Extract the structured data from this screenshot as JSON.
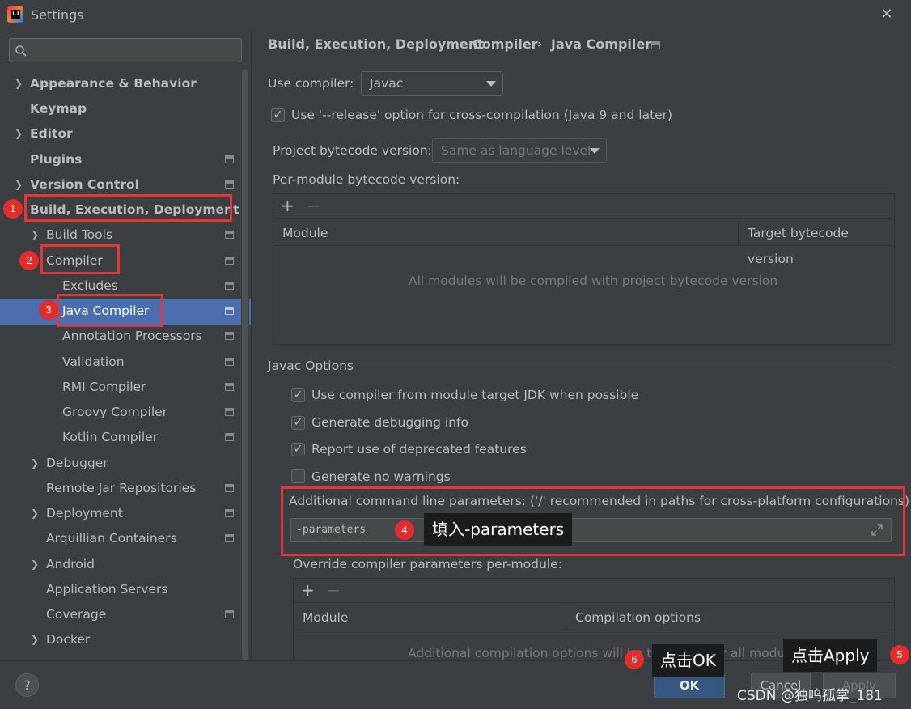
{
  "window": {
    "title": "Settings",
    "close": "✕"
  },
  "search": {
    "placeholder": ""
  },
  "sidebar": {
    "items": [
      {
        "label": "Appearance & Behavior"
      },
      {
        "label": "Keymap"
      },
      {
        "label": "Editor"
      },
      {
        "label": "Plugins"
      },
      {
        "label": "Version Control"
      },
      {
        "label": "Build, Execution, Deployment"
      },
      {
        "label": "Build Tools"
      },
      {
        "label": "Compiler"
      },
      {
        "label": "Excludes"
      },
      {
        "label": "Java Compiler"
      },
      {
        "label": "Annotation Processors"
      },
      {
        "label": "Validation"
      },
      {
        "label": "RMI Compiler"
      },
      {
        "label": "Groovy Compiler"
      },
      {
        "label": "Kotlin Compiler"
      },
      {
        "label": "Debugger"
      },
      {
        "label": "Remote Jar Repositories"
      },
      {
        "label": "Deployment"
      },
      {
        "label": "Arquillian Containers"
      },
      {
        "label": "Android"
      },
      {
        "label": "Application Servers"
      },
      {
        "label": "Coverage"
      },
      {
        "label": "Docker"
      }
    ],
    "selected": "Java Compiler"
  },
  "breadcrumb": {
    "part1": "Build, Execution, Deployment",
    "part2": "Compiler",
    "part3": "Java Compiler",
    "separator": "›"
  },
  "form": {
    "use_compiler_label": "Use compiler:",
    "use_compiler_value": "Javac",
    "release_option_label": "Use '--release' option for cross-compilation (Java 9 and later)",
    "release_option_checked": true,
    "bytecode_label": "Project bytecode version:",
    "bytecode_value": "Same as language level",
    "per_module_label": "Per-module bytecode version:",
    "module_table": {
      "columns": [
        "Module",
        "Target bytecode version"
      ],
      "empty_text": "All modules will be compiled with project bytecode version"
    },
    "javac_options_label": "Javac Options",
    "javac_checks": [
      {
        "label": "Use compiler from module target JDK when possible",
        "checked": true
      },
      {
        "label": "Generate debugging info",
        "checked": true
      },
      {
        "label": "Report use of deprecated features",
        "checked": true
      },
      {
        "label": "Generate no warnings",
        "checked": false
      }
    ],
    "additional_params_label": "Additional command line parameters:",
    "additional_params_hint": "('/' recommended in paths for cross-platform configurations)",
    "additional_params_value": "-parameters",
    "override_label": "Override compiler parameters per-module:",
    "override_table": {
      "columns": [
        "Module",
        "Compilation options"
      ],
      "empty_text": "Additional compilation options will be the same for all modules"
    }
  },
  "annotations": {
    "badges": [
      "1",
      "2",
      "3",
      "4",
      "5",
      "6"
    ],
    "tip4": "填入-parameters",
    "tip5": "点击Apply",
    "tip6": "点击OK"
  },
  "footer": {
    "help": "?",
    "ok": "OK",
    "cancel": "Cancel",
    "apply": "Apply",
    "watermark": "CSDN @独呜孤掌_181"
  },
  "colors": {
    "selection": "#4b6eaf",
    "annotation_red": "#e53535",
    "ok_button": "#365880"
  }
}
